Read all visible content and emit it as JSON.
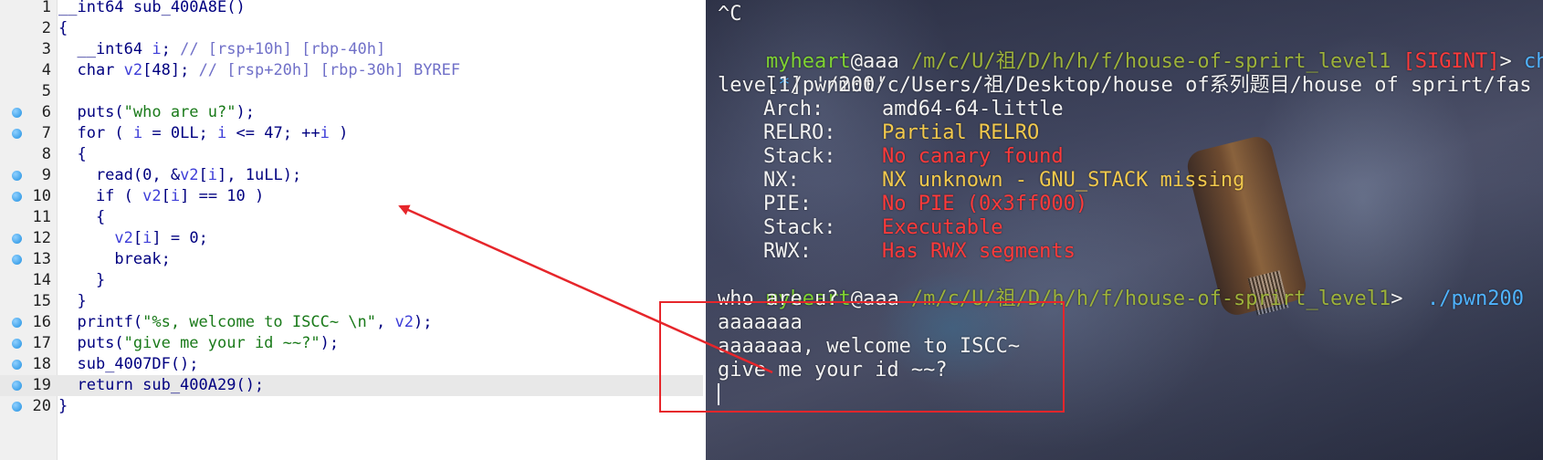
{
  "code": {
    "lines": [
      {
        "num": "1",
        "bp": false,
        "text": "__int64 sub_400A8E()"
      },
      {
        "num": "2",
        "bp": false,
        "text": "{"
      },
      {
        "num": "3",
        "bp": false,
        "text": "  __int64 i; // [rsp+10h] [rbp-40h]"
      },
      {
        "num": "4",
        "bp": false,
        "text": "  char v2[48]; // [rsp+20h] [rbp-30h] BYREF"
      },
      {
        "num": "5",
        "bp": false,
        "text": ""
      },
      {
        "num": "6",
        "bp": true,
        "text": "  puts(\"who are u?\");"
      },
      {
        "num": "7",
        "bp": true,
        "text": "  for ( i = 0LL; i <= 47; ++i )"
      },
      {
        "num": "8",
        "bp": false,
        "text": "  {"
      },
      {
        "num": "9",
        "bp": true,
        "text": "    read(0, &v2[i], 1uLL);"
      },
      {
        "num": "10",
        "bp": true,
        "text": "    if ( v2[i] == 10 )"
      },
      {
        "num": "11",
        "bp": false,
        "text": "    {"
      },
      {
        "num": "12",
        "bp": true,
        "text": "      v2[i] = 0;"
      },
      {
        "num": "13",
        "bp": true,
        "text": "      break;"
      },
      {
        "num": "14",
        "bp": false,
        "text": "    }"
      },
      {
        "num": "15",
        "bp": false,
        "text": "  }"
      },
      {
        "num": "16",
        "bp": true,
        "text": "  printf(\"%s, welcome to ISCC~ \\n\", v2);"
      },
      {
        "num": "17",
        "bp": true,
        "text": "  puts(\"give me your id ~~?\");"
      },
      {
        "num": "18",
        "bp": true,
        "text": "  sub_4007DF();"
      },
      {
        "num": "19",
        "bp": true,
        "text": "  return sub_400A29();"
      },
      {
        "num": "20",
        "bp": true,
        "text": "}"
      }
    ],
    "highlight_line": "19"
  },
  "terminal": {
    "ctrl_c": "^C",
    "prompt1": {
      "user": "myheart",
      "host": "@aaa",
      "path": " /m/c/U/祖/D/h/h/f/house-of-sprirt_level1",
      "signal": " [SIGINT]",
      "arrow": "> ",
      "cmd": "ch"
    },
    "info_line_a": {
      "bracket_l": "[",
      "star": "*",
      "bracket_r": "]",
      "path": " '/mnt/c/Users/祖/Desktop/house of系列题目/house of sprirt/fas"
    },
    "info_line_b": "level1/pwn200'",
    "checksec": [
      {
        "label": "Arch:",
        "value": "amd64-64-little",
        "color": "#f2f2f2"
      },
      {
        "label": "RELRO:",
        "value": "Partial RELRO",
        "color": "#f2c94c"
      },
      {
        "label": "Stack:",
        "value": "No canary found",
        "color": "#ff3a3a"
      },
      {
        "label": "NX:",
        "value": "NX unknown - GNU_STACK missing",
        "color": "#f2c94c"
      },
      {
        "label": "PIE:",
        "value": "No PIE (0x3ff000)",
        "color": "#ff3a3a"
      },
      {
        "label": "Stack:",
        "value": "Executable",
        "color": "#ff3a3a"
      },
      {
        "label": "RWX:",
        "value": "Has RWX segments",
        "color": "#ff3a3a"
      }
    ],
    "prompt2": {
      "user": "myheart",
      "host": "@aaa",
      "path": " /m/c/U/祖/D/h/h/f/house-of-sprirt_level1",
      "arrow": "> ",
      "cmd": " ./pwn200"
    },
    "output": [
      "who are u?",
      "aaaaaaa",
      "aaaaaaa, welcome to ISCC~",
      "give me your id ~~?"
    ]
  },
  "colors": {
    "annotation": "#e6262b",
    "breakpoint": "#1f8fe0",
    "prompt_user": "#7fd332",
    "prompt_cmd": "#4fb3ff",
    "danger": "#ff3a3a",
    "warn": "#f2c94c"
  }
}
